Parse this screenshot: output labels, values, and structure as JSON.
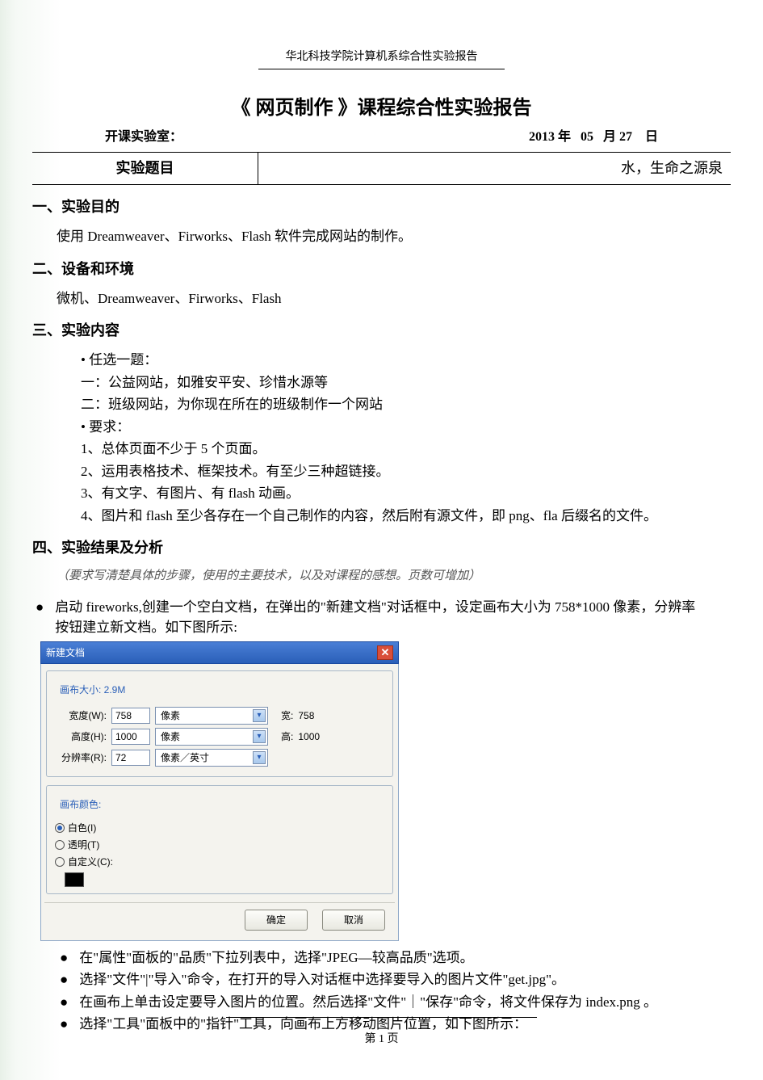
{
  "header": "华北科技学院计算机系综合性实验报告",
  "title": "《 网页制作 》课程综合性实验报告",
  "lab_label": "开课实验室：",
  "date": {
    "year": "2013",
    "y_unit": "年",
    "month": "05",
    "m_unit": "月",
    "day": "27",
    "d_unit": "日"
  },
  "topic": {
    "label": "实验题目",
    "value": "水，生命之源泉"
  },
  "sections": {
    "s1": {
      "h": "一、实验目的",
      "p": "使用 Dreamweaver、Firworks、Flash 软件完成网站的制作。"
    },
    "s2": {
      "h": "二、设备和环境",
      "p": "微机、Dreamweaver、Firworks、Flash"
    },
    "s3": {
      "h": "三、实验内容",
      "items": [
        "任选一题：",
        "一：公益网站，如雅安平安、珍惜水源等",
        "二：班级网站，为你现在所在的班级制作一个网站",
        "要求：",
        "1、总体页面不少于 5 个页面。",
        "2、运用表格技术、框架技术。有至少三种超链接。",
        "3、有文字、有图片、有 flash 动画。",
        "4、图片和 flash 至少各存在一个自己制作的内容，然后附有源文件，即 png、fla 后缀名的文件。"
      ],
      "dot_indices": [
        0,
        3
      ]
    },
    "s4": {
      "h": "四、实验结果及分析",
      "note": "（要求写清楚具体的步骤，使用的主要技术，以及对课程的感想。页数可增加）"
    }
  },
  "step1_line1": "启动 fireworks,创建一个空白文档，在弹出的\"新建文档\"对话框中，设定画布大小为 758*1000 像素，分辨率",
  "step1_line2": "按钮建立新文档。如下图所示:",
  "dialog": {
    "title": "新建文档",
    "canvas_size_label": "画布大小: 2.9M",
    "width_label": "宽度(W):",
    "width_val": "758",
    "width_unit": "像素",
    "width_out_label": "宽:",
    "width_out": "758",
    "height_label": "高度(H):",
    "height_val": "1000",
    "height_unit": "像素",
    "height_out_label": "高:",
    "height_out": "1000",
    "res_label": "分辨率(R):",
    "res_val": "72",
    "res_unit": "像素／英寸",
    "color_label": "画布颜色:",
    "opt_white": "白色(I)",
    "opt_trans": "透明(T)",
    "opt_custom": "自定义(C):",
    "ok": "确定",
    "cancel": "取消"
  },
  "steps_after": [
    "在\"属性\"面板的\"品质\"下拉列表中，选择\"JPEG—较高品质\"选项。",
    "选择\"文件\"|\"导入\"命令，在打开的导入对话框中选择要导入的图片文件\"get.jpg\"。",
    "在画布上单击设定要导入图片的位置。然后选择\"文件\"｜\"保存\"命令，将文件保存为 index.png 。",
    "选择\"工具\"面板中的\"指针\"工具，向画布上方移动图片位置，如下图所示："
  ],
  "footer": "第 1 页"
}
